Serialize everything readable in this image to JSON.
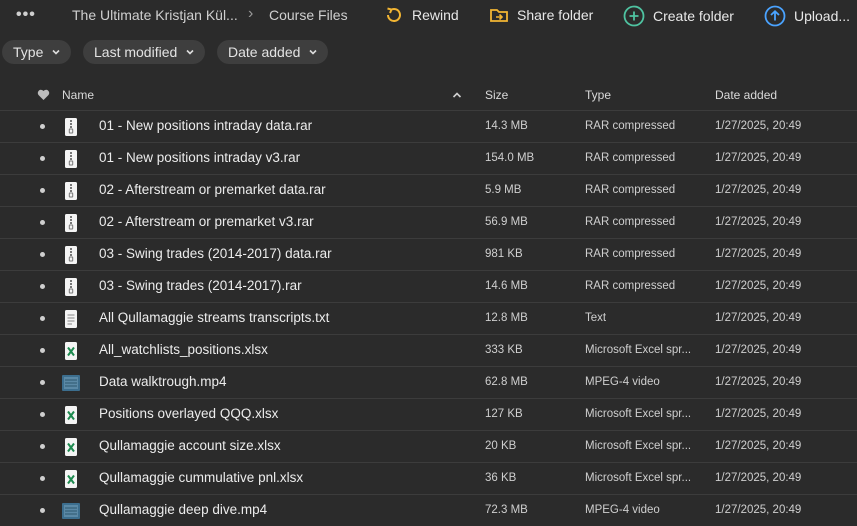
{
  "breadcrumb": {
    "menu_icon": "more-dots-icon",
    "root": "The Ultimate Kristjan Kül...",
    "current": "Course Files"
  },
  "toolbar": {
    "rewind": "Rewind",
    "share_folder": "Share folder",
    "create_folder": "Create folder",
    "upload": "Upload..."
  },
  "filters": {
    "type": "Type",
    "last_modified": "Last modified",
    "date_added": "Date added"
  },
  "columns": {
    "name": "Name",
    "size": "Size",
    "type": "Type",
    "date_added": "Date added"
  },
  "colors": {
    "background": "#2b2b2b",
    "rewind_accent": "#f2b533",
    "share_accent": "#f2b533",
    "create_accent": "#4fc3a1",
    "upload_accent": "#4aa3ff",
    "excel_green": "#1d8a4f"
  },
  "files": [
    {
      "icon": "archive-icon",
      "name": "01 - New positions intraday data.rar",
      "size": "14.3 MB",
      "type": "RAR compressed",
      "date": "1/27/2025, 20:49"
    },
    {
      "icon": "archive-icon",
      "name": "01 - New positions intraday v3.rar",
      "size": "154.0 MB",
      "type": "RAR compressed",
      "date": "1/27/2025, 20:49"
    },
    {
      "icon": "archive-icon",
      "name": "02 - Afterstream or premarket data.rar",
      "size": "5.9 MB",
      "type": "RAR compressed",
      "date": "1/27/2025, 20:49"
    },
    {
      "icon": "archive-icon",
      "name": "02 - Afterstream or premarket v3.rar",
      "size": "56.9 MB",
      "type": "RAR compressed",
      "date": "1/27/2025, 20:49"
    },
    {
      "icon": "archive-icon",
      "name": "03 - Swing trades (2014-2017) data.rar",
      "size": "981 KB",
      "type": "RAR compressed",
      "date": "1/27/2025, 20:49"
    },
    {
      "icon": "archive-icon",
      "name": "03 - Swing trades (2014-2017).rar",
      "size": "14.6 MB",
      "type": "RAR compressed",
      "date": "1/27/2025, 20:49"
    },
    {
      "icon": "text-file-icon",
      "name": "All Qullamaggie streams transcripts.txt",
      "size": "12.8 MB",
      "type": "Text",
      "date": "1/27/2025, 20:49"
    },
    {
      "icon": "excel-file-icon",
      "name": "All_watchlists_positions.xlsx",
      "size": "333 KB",
      "type": "Microsoft Excel spr...",
      "date": "1/27/2025, 20:49"
    },
    {
      "icon": "video-file-icon",
      "name": "Data walktrough.mp4",
      "size": "62.8 MB",
      "type": "MPEG-4 video",
      "date": "1/27/2025, 20:49"
    },
    {
      "icon": "excel-file-icon",
      "name": "Positions overlayed QQQ.xlsx",
      "size": "127 KB",
      "type": "Microsoft Excel spr...",
      "date": "1/27/2025, 20:49"
    },
    {
      "icon": "excel-file-icon",
      "name": "Qullamaggie account size.xlsx",
      "size": "20 KB",
      "type": "Microsoft Excel spr...",
      "date": "1/27/2025, 20:49"
    },
    {
      "icon": "excel-file-icon",
      "name": "Qullamaggie cummulative pnl.xlsx",
      "size": "36 KB",
      "type": "Microsoft Excel spr...",
      "date": "1/27/2025, 20:49"
    },
    {
      "icon": "video-file-icon",
      "name": "Qullamaggie deep dive.mp4",
      "size": "72.3 MB",
      "type": "MPEG-4 video",
      "date": "1/27/2025, 20:49"
    }
  ]
}
